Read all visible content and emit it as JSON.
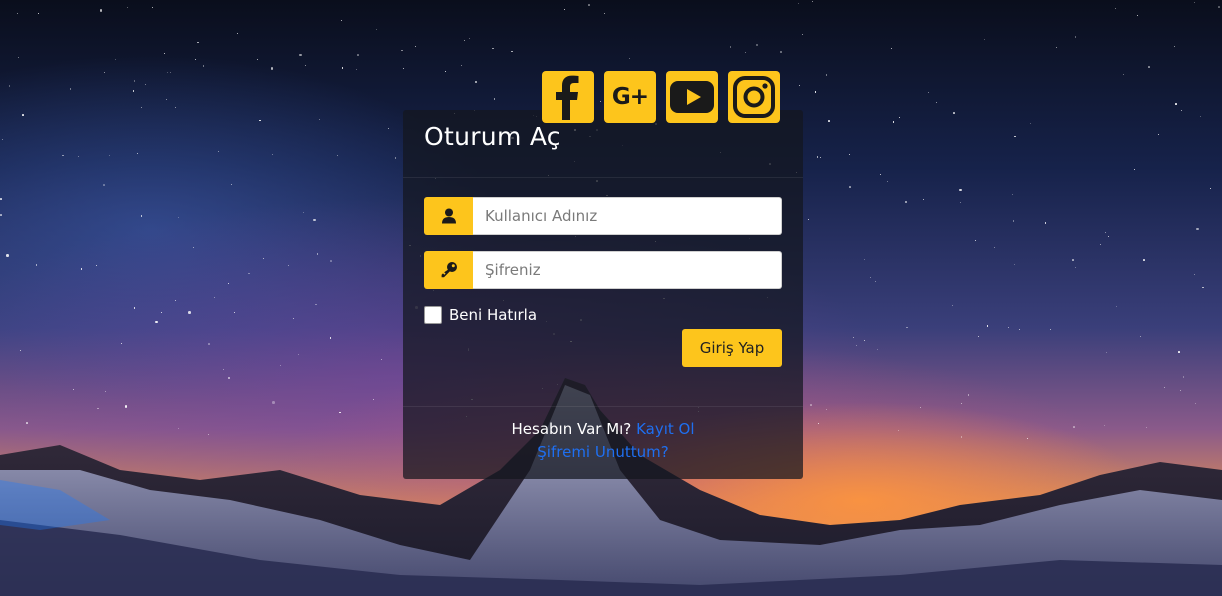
{
  "social": {
    "icons": [
      {
        "name": "facebook-icon"
      },
      {
        "name": "google-plus-icon"
      },
      {
        "name": "youtube-icon"
      },
      {
        "name": "instagram-icon"
      }
    ],
    "google_plus_glyph": "G+",
    "accent_color": "#fdc51c"
  },
  "login": {
    "title": "Oturum Aç",
    "username": {
      "placeholder": "Kullanıcı Adınız",
      "value": "",
      "icon": "user-icon"
    },
    "password": {
      "placeholder": "Şifreniz",
      "value": "",
      "icon": "key-icon"
    },
    "remember_label": "Beni Hatırla",
    "remember_checked": false,
    "submit_label": "Giriş Yap",
    "footer": {
      "question": "Hesabın Var Mı?",
      "register_link": "Kayıt Ol",
      "forgot_link": "Şifremi Unuttum?"
    },
    "link_color": "#1f6ff0"
  }
}
